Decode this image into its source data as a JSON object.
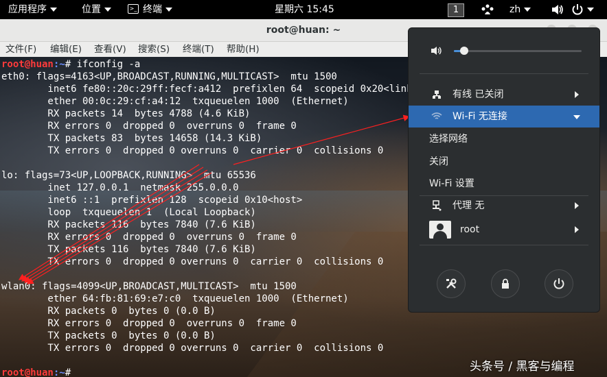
{
  "topbar": {
    "applications": "应用程序",
    "places": "位置",
    "terminal_app": "终端",
    "clock": "星期六 15:45",
    "workspace": "1",
    "input_method": "zh"
  },
  "window": {
    "title": "root@huan: ~",
    "menus": [
      "文件(F)",
      "编辑(E)",
      "查看(V)",
      "搜索(S)",
      "终端(T)",
      "帮助(H)"
    ]
  },
  "terminal": {
    "prompt_user": "root@huan",
    "prompt_path": ":~",
    "command": "# ifconfig -a",
    "output": [
      "eth0: flags=4163<UP,BROADCAST,RUNNING,MULTICAST>  mtu 1500",
      "        inet6 fe80::20c:29ff:fecf:a412  prefixlen 64  scopeid 0x20<link>",
      "        ether 00:0c:29:cf:a4:12  txqueuelen 1000  (Ethernet)",
      "        RX packets 14  bytes 4788 (4.6 KiB)",
      "        RX errors 0  dropped 0  overruns 0  frame 0",
      "        TX packets 83  bytes 14658 (14.3 KiB)",
      "        TX errors 0  dropped 0 overruns 0  carrier 0  collisions 0",
      "",
      "lo: flags=73<UP,LOOPBACK,RUNNING>  mtu 65536",
      "        inet 127.0.0.1  netmask 255.0.0.0",
      "        inet6 ::1  prefixlen 128  scopeid 0x10<host>",
      "        loop  txqueuelen 1  (Local Loopback)",
      "        RX packets 116  bytes 7840 (7.6 KiB)",
      "        RX errors 0  dropped 0  overruns 0  frame 0",
      "        TX packets 116  bytes 7840 (7.6 KiB)",
      "        TX errors 0  dropped 0 overruns 0  carrier 0  collisions 0",
      "",
      "wlan0: flags=4099<UP,BROADCAST,MULTICAST>  mtu 1500",
      "        ether 64:fb:81:69:e7:c0  txqueuelen 1000  (Ethernet)",
      "        RX packets 0  bytes 0 (0.0 B)",
      "        RX errors 0  dropped 0  overruns 0  frame 0",
      "        TX packets 0  bytes 0 (0.0 B)",
      "        TX errors 0  dropped 0 overruns 0  carrier 0  collisions 0",
      ""
    ],
    "final_command": "#"
  },
  "system_menu": {
    "volume_level": 0.08,
    "wired": "有线 已关闭",
    "wifi": "Wi-Fi 无连接",
    "select_network": "选择网络",
    "turn_off": "关闭",
    "wifi_settings": "Wi-Fi 设置",
    "proxy": "代理 无",
    "user": "root",
    "accent": "#2d69b1"
  },
  "watermark": "头条号 / 黑客与编程"
}
